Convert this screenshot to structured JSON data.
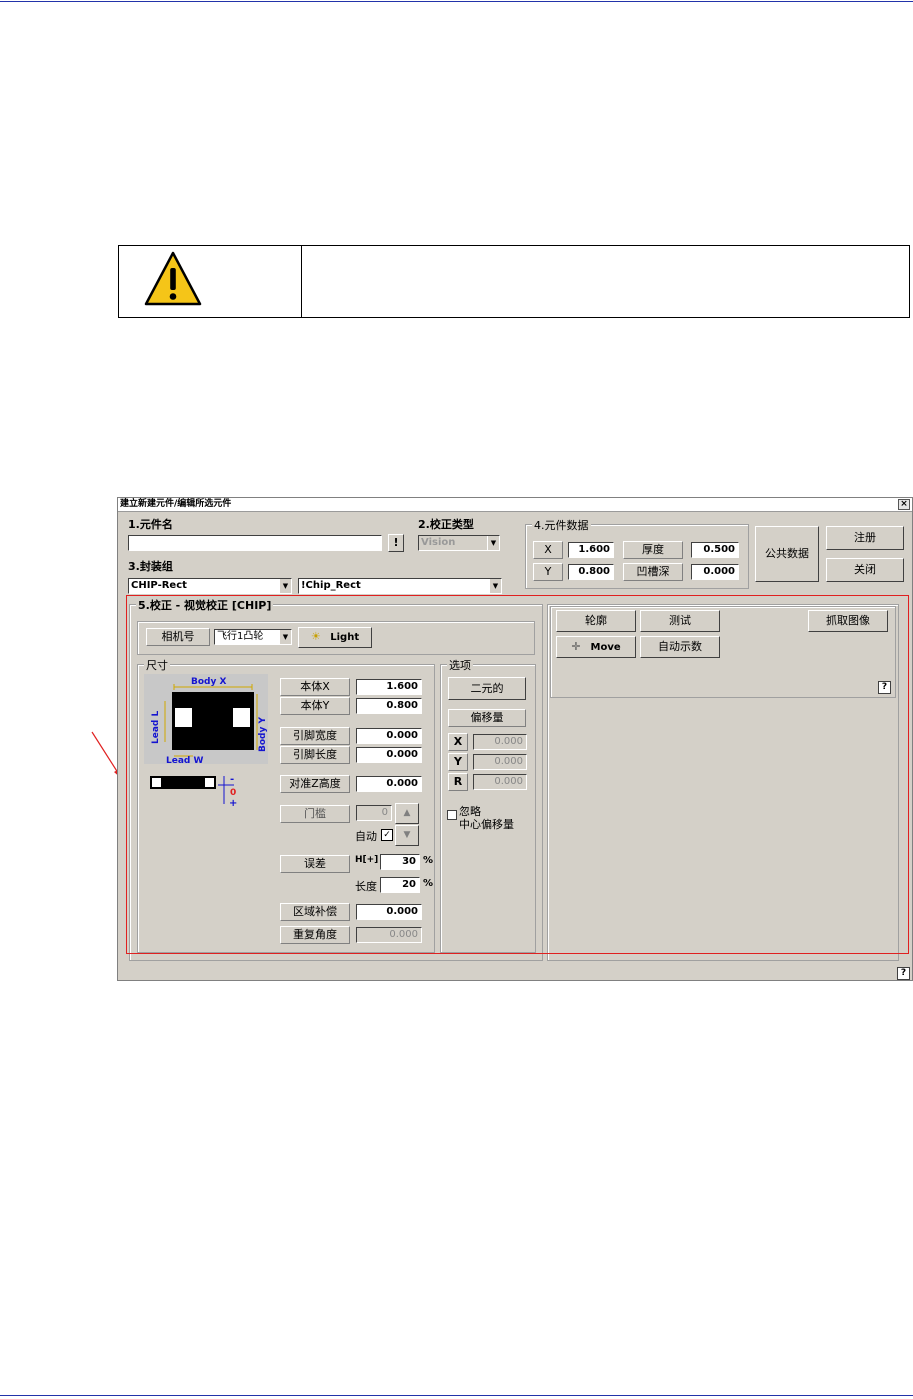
{
  "dialog": {
    "title": "建立新建元件/编辑所选元件",
    "close_glyph": "×",
    "sec1_label": "1.元件名",
    "name_value": "",
    "excl_button": "!",
    "sec2_label": "2.校正类型",
    "calib_type": "Vision",
    "sec3_label": "3.封装组",
    "pkg_group": "CHIP-Rect",
    "pkg_name": "!Chip_Rect",
    "sec4_label": "4.元件数据",
    "x_label": "X",
    "x_value": "1.600",
    "thick_label": "厚度",
    "thick_value": "0.500",
    "y_label": "Y",
    "y_value": "0.800",
    "groove_label": "凹槽深",
    "groove_value": "0.000",
    "common_data_button": "公共数据",
    "register_button": "注册",
    "close_button": "关闭",
    "sec5_label": "5.校正 - 视觉校正 [CHIP]",
    "camera_label": "相机号",
    "camera_value": "飞行1凸轮",
    "light_button": "Light",
    "size_group": "尺寸",
    "body_x_label": "本体X",
    "body_x_value": "1.600",
    "body_y_label": "本体Y",
    "body_y_value": "0.800",
    "pin_width_label": "引脚宽度",
    "pin_width_value": "0.000",
    "pin_length_label": "引脚长度",
    "pin_length_value": "0.000",
    "z_height_label": "对准Z高度",
    "z_height_value": "0.000",
    "threshold_label": "门槛",
    "threshold_value": "0",
    "auto_label": "自动",
    "error_label": "误差",
    "h_label": "H[+]",
    "h_value": "30",
    "len_label": "长度",
    "len_value": "20",
    "percent": "%",
    "area_comp_label": "区域补偿",
    "area_comp_value": "0.000",
    "repeat_angle_label": "重复角度",
    "repeat_angle_value": "0.000",
    "options_group": "选项",
    "binary_button": "二元的",
    "offset_label": "偏移量",
    "off_x_label": "X",
    "off_x_value": "0.000",
    "off_y_label": "Y",
    "off_y_value": "0.000",
    "off_r_label": "R",
    "off_r_value": "0.000",
    "ignore_label_1": "忽略",
    "ignore_label_2": "中心偏移量",
    "contour_button": "轮廓",
    "test_button": "测试",
    "grab_button": "抓取图像",
    "move_button": "Move",
    "auto_teach_button": "自动示数",
    "help_glyph": "?",
    "diagram": {
      "body_x": "Body X",
      "body_y": "Body Y",
      "lead_l": "Lead L",
      "lead_w": "Lead W",
      "minus": "-",
      "zero": "0",
      "plus": "+"
    }
  },
  "colors": {
    "rule": "#2233aa",
    "warning_fill": "#f5c518",
    "highlight": "#e02020",
    "dialog_bg": "#d4d0c8"
  }
}
